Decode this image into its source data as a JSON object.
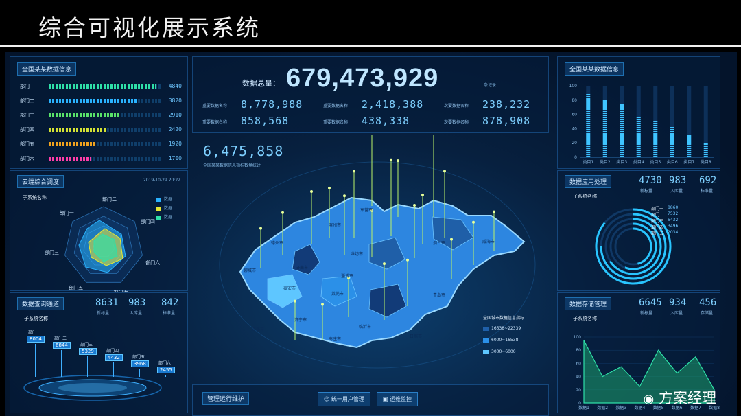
{
  "header": {
    "title": "综合可视化展示系统"
  },
  "left": {
    "dept_panel": {
      "title": "全国某某数据信息",
      "rows": [
        {
          "label": "部门一",
          "value": "4840",
          "ratio": 0.95,
          "color": "#2fe0a8"
        },
        {
          "label": "部门二",
          "value": "3820",
          "ratio": 0.78,
          "color": "#2ab3ff"
        },
        {
          "label": "部门三",
          "value": "2910",
          "ratio": 0.62,
          "color": "#59e36a"
        },
        {
          "label": "部门四",
          "value": "2420",
          "ratio": 0.52,
          "color": "#d4e234"
        },
        {
          "label": "部门五",
          "value": "1920",
          "ratio": 0.42,
          "color": "#f0a21e"
        },
        {
          "label": "部门六",
          "value": "1700",
          "ratio": 0.37,
          "color": "#ff3da8"
        }
      ]
    },
    "radar_panel": {
      "title": "云端综合调度",
      "date": "2019-10-29 20:22",
      "subtitle": "子系统名称",
      "axes": [
        "部门一",
        "部门二",
        "部门四",
        "部门六",
        "部门七",
        "部门五",
        "部门三"
      ],
      "legend": [
        "数据",
        "数据",
        "数据"
      ],
      "legend_colors": [
        "#2ab3ff",
        "#e8e832",
        "#2fe0a8"
      ]
    },
    "query_panel": {
      "title": "数据查询通道",
      "subtitle": "子系统名称",
      "stats": [
        {
          "value": "8631",
          "label": "新标量"
        },
        {
          "value": "983",
          "label": "入库量"
        },
        {
          "value": "842",
          "label": "标准量"
        }
      ],
      "tags": [
        {
          "label": "部门一",
          "value": "8004"
        },
        {
          "label": "部门二",
          "value": "6844"
        },
        {
          "label": "部门三",
          "value": "5329"
        },
        {
          "label": "部门四",
          "value": "4432"
        },
        {
          "label": "部门五",
          "value": "3968"
        },
        {
          "label": "部门六",
          "value": "2455"
        }
      ]
    }
  },
  "center": {
    "total_label": "数据总量：",
    "total_value": "679,473,929",
    "total_unit": "条记录",
    "metrics": [
      {
        "label": "重要数据名称",
        "value": "8,778,988"
      },
      {
        "label": "重要数据名称",
        "value": "2,418,388"
      },
      {
        "label": "次要数据名称",
        "value": "238,232"
      },
      {
        "label": "重要数据名称",
        "value": "858,568"
      },
      {
        "label": "重要数据名称",
        "value": "438,338"
      },
      {
        "label": "次要数据名称",
        "value": "878,908"
      }
    ],
    "map_value": "6,475,858",
    "map_caption": "全国某某数据信息指标数量统计",
    "map_legend_title": "全国城市数据信息指标",
    "map_legend": [
      {
        "label": "16538~22339",
        "color": "#1f5fa8"
      },
      {
        "label": "6000~16538",
        "color": "#2b90e8"
      },
      {
        "label": "3000~6000",
        "color": "#5ec6ff"
      }
    ],
    "cities": [
      "德州市",
      "滨州市",
      "东营市",
      "潍坊市",
      "烟台市",
      "威海市",
      "聊城市",
      "济南市",
      "淄博市",
      "青岛市",
      "泰安市",
      "莱芜市",
      "日照市",
      "菏泽市",
      "济宁市",
      "临沂市",
      "枣庄市"
    ],
    "ops_title": "管理运行维护",
    "ops_buttons": [
      "统一用户管理",
      "运维监控"
    ]
  },
  "right": {
    "bars_panel": {
      "title": "全国某某数据信息",
      "chart_data": {
        "type": "bar",
        "categories": [
          "类目1",
          "类目2",
          "类目3",
          "类目4",
          "类目5",
          "类目6",
          "类目7",
          "类目8"
        ],
        "values": [
          90,
          80,
          75,
          58,
          52,
          45,
          32,
          22
        ],
        "ylim": [
          0,
          100
        ],
        "yticks": [
          "0",
          "20",
          "40",
          "60",
          "80",
          "100"
        ]
      }
    },
    "apps_panel": {
      "title": "数据应用处理",
      "subtitle": "子系统名称",
      "stats": [
        {
          "value": "4730",
          "label": "新标量"
        },
        {
          "value": "983",
          "label": "入库量"
        },
        {
          "value": "692",
          "label": "标准量"
        }
      ],
      "rings": [
        {
          "label": "部门一",
          "value": "8860"
        },
        {
          "label": "部门二",
          "value": "7532"
        },
        {
          "label": "部门三",
          "value": "6432"
        },
        {
          "label": "部门四",
          "value": "3496"
        },
        {
          "label": "部门五",
          "value": "2034"
        }
      ]
    },
    "storage_panel": {
      "title": "数据存储管理",
      "subtitle": "子系统名称",
      "stats": [
        {
          "value": "6645",
          "label": "新标量"
        },
        {
          "value": "934",
          "label": "入库量"
        },
        {
          "value": "456",
          "label": "存储量"
        }
      ],
      "chart_data": {
        "type": "area",
        "categories": [
          "数据1",
          "数据2",
          "数据3",
          "数据4",
          "数据5",
          "数据6",
          "数据7",
          "数据8"
        ],
        "values": [
          95,
          40,
          55,
          25,
          80,
          45,
          70,
          20
        ],
        "ylim": [
          0,
          100
        ],
        "yticks": [
          "0",
          "20",
          "40",
          "60",
          "80",
          "100"
        ]
      }
    }
  },
  "watermark": "方案经理"
}
